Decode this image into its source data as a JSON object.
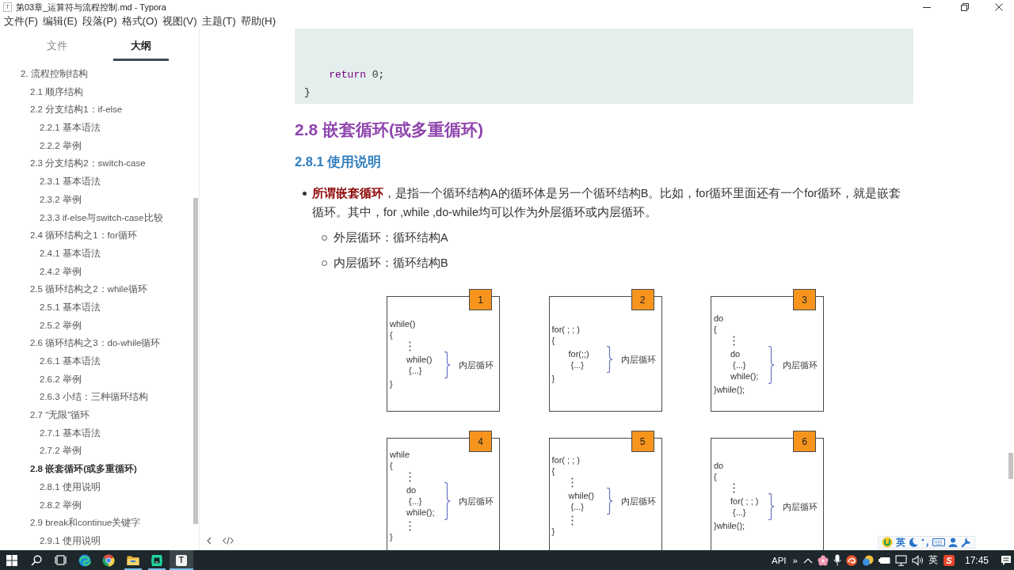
{
  "window": {
    "logo": "T",
    "title": "第03章_运算符与流程控制.md - Typora"
  },
  "menu": [
    "文件(F)",
    "编辑(E)",
    "段落(P)",
    "格式(O)",
    "视图(V)",
    "主题(T)",
    "帮助(H)"
  ],
  "sidebar": {
    "tabs": [
      {
        "label": "文件",
        "selected": false
      },
      {
        "label": "大纲",
        "selected": true
      }
    ],
    "outline": [
      {
        "label": "2. 流程控制结构",
        "selected": false,
        "children": [
          {
            "label": "2.1 顺序结构",
            "selected": false
          },
          {
            "label": "2.2 分支结构1：if-else",
            "selected": false,
            "children": [
              {
                "label": "2.2.1 基本语法",
                "selected": false
              },
              {
                "label": "2.2.2 举例",
                "selected": false
              }
            ]
          },
          {
            "label": "2.3 分支结构2：switch-case",
            "selected": false,
            "children": [
              {
                "label": "2.3.1 基本语法",
                "selected": false
              },
              {
                "label": "2.3.2 举例",
                "selected": false
              },
              {
                "label": "2.3.3 if-else与switch-case比较",
                "selected": false
              }
            ]
          },
          {
            "label": "2.4 循环结构之1：for循环",
            "selected": false,
            "children": [
              {
                "label": "2.4.1 基本语法",
                "selected": false
              },
              {
                "label": "2.4.2 举例",
                "selected": false
              }
            ]
          },
          {
            "label": "2.5 循环结构之2：while循环",
            "selected": false,
            "children": [
              {
                "label": "2.5.1 基本语法",
                "selected": false
              },
              {
                "label": "2.5.2 举例",
                "selected": false
              }
            ]
          },
          {
            "label": "2.6 循环结构之3：do-while循环",
            "selected": false,
            "children": [
              {
                "label": "2.6.1 基本语法",
                "selected": false
              },
              {
                "label": "2.6.2 举例",
                "selected": false
              },
              {
                "label": "2.6.3 小结：三种循环结构",
                "selected": false
              }
            ]
          },
          {
            "label": "2.7 \"无限\"循环",
            "selected": false,
            "children": [
              {
                "label": "2.7.1 基本语法",
                "selected": false
              },
              {
                "label": "2.7.2 举例",
                "selected": false
              }
            ]
          },
          {
            "label": "2.8 嵌套循环(或多重循环)",
            "selected": true,
            "children": [
              {
                "label": "2.8.1 使用说明",
                "selected": false
              },
              {
                "label": "2.8.2 举例",
                "selected": false
              }
            ]
          },
          {
            "label": "2.9 break和continue关键字",
            "selected": false,
            "children": [
              {
                "label": "2.9.1 使用说明",
                "selected": false
              }
            ]
          }
        ]
      }
    ]
  },
  "editor": {
    "code_block": {
      "lines": [
        [
          {
            "kind": "keyword",
            "text": "    return"
          },
          {
            "kind": "plain",
            "text": " 0;"
          }
        ],
        [
          {
            "kind": "plain",
            "text": "}"
          }
        ]
      ]
    },
    "heading": "2.8 嵌套循环(或多重循环)",
    "subheading": "2.8.1 使用说明",
    "bullets": [
      {
        "text": "**所谓嵌套循环**，是指一个循环结构A的循环体是另一个循环结构B。比如，for循环里面还有一个for循环，就是嵌套循环。其中，for ,while ,do-while均可以作为外层循环或内层循环。",
        "children": [
          {
            "text": "外层循环：循环结构A"
          },
          {
            "text": "内层循环：循环结构B"
          }
        ]
      }
    ],
    "figure": {
      "diagrams": [
        {
          "number": "1",
          "head": [
            "while()",
            "{"
          ],
          "inner": [
            {
              "kind": "dots"
            },
            {
              "kind": "loop",
              "lines": [
                {
                  "kind": "code",
                  "text": "while()"
                },
                {
                  "kind": "body",
                  "text": "{...}"
                }
              ],
              "label": "内层循环"
            }
          ],
          "tail": [
            "}"
          ]
        },
        {
          "number": "2",
          "head": [
            "for( ; ; )",
            "{"
          ],
          "inner": [
            {
              "kind": "loop",
              "lines": [
                {
                  "kind": "code",
                  "text": "for(;;)"
                },
                {
                  "kind": "body",
                  "text": "{...}"
                }
              ],
              "label": "内层循环"
            }
          ],
          "tail": [
            "}"
          ]
        },
        {
          "number": "3",
          "head": [
            "do",
            "{"
          ],
          "inner": [
            {
              "kind": "dots"
            },
            {
              "kind": "loop",
              "lines": [
                {
                  "kind": "code",
                  "text": "do"
                },
                {
                  "kind": "body",
                  "text": "{...}"
                },
                {
                  "kind": "code",
                  "text": "while();"
                }
              ],
              "label": "内层循环"
            }
          ],
          "tail": [
            "}while();"
          ]
        },
        {
          "number": "4",
          "head": [
            "while",
            "{"
          ],
          "inner": [
            {
              "kind": "dots"
            },
            {
              "kind": "loop",
              "lines": [
                {
                  "kind": "code",
                  "text": "do"
                },
                {
                  "kind": "body",
                  "text": "{...}"
                },
                {
                  "kind": "code",
                  "text": "while();"
                }
              ],
              "label": "内层循环"
            },
            {
              "kind": "dots"
            }
          ],
          "tail": [
            "}"
          ]
        },
        {
          "number": "5",
          "head": [
            "for( ; ; )",
            "{"
          ],
          "inner": [
            {
              "kind": "dots"
            },
            {
              "kind": "loop",
              "lines": [
                {
                  "kind": "code",
                  "text": "while()"
                },
                {
                  "kind": "body",
                  "text": "{...}"
                }
              ],
              "label": "内层循环"
            },
            {
              "kind": "dots"
            }
          ],
          "tail": [
            "}"
          ]
        },
        {
          "number": "6",
          "head": [
            "do",
            "{"
          ],
          "inner": [
            {
              "kind": "dots"
            },
            {
              "kind": "loop",
              "lines": [
                {
                  "kind": "code",
                  "text": "for( ; ; )"
                },
                {
                  "kind": "body",
                  "text": "{...}"
                }
              ],
              "label": "内层循环"
            }
          ],
          "tail": [
            "}while();"
          ]
        }
      ]
    }
  },
  "ime_bar": {
    "mode": "英"
  },
  "taskbar": {
    "apps": [
      {
        "kind": "start",
        "running": false,
        "selected": false
      },
      {
        "kind": "search",
        "running": false,
        "selected": false
      },
      {
        "kind": "task_view",
        "running": false,
        "selected": false
      },
      {
        "kind": "edge",
        "running": false,
        "selected": false
      },
      {
        "kind": "chrome",
        "running": false,
        "selected": false
      },
      {
        "kind": "explorer",
        "running": true,
        "selected": false
      },
      {
        "kind": "app",
        "running": true,
        "selected": false
      },
      {
        "kind": "letter",
        "letter": "T",
        "running": true,
        "selected": true
      }
    ],
    "tray": {
      "label": "API",
      "overflow": "»",
      "language": "英",
      "ime_letter": "S",
      "time": "17:45"
    }
  }
}
